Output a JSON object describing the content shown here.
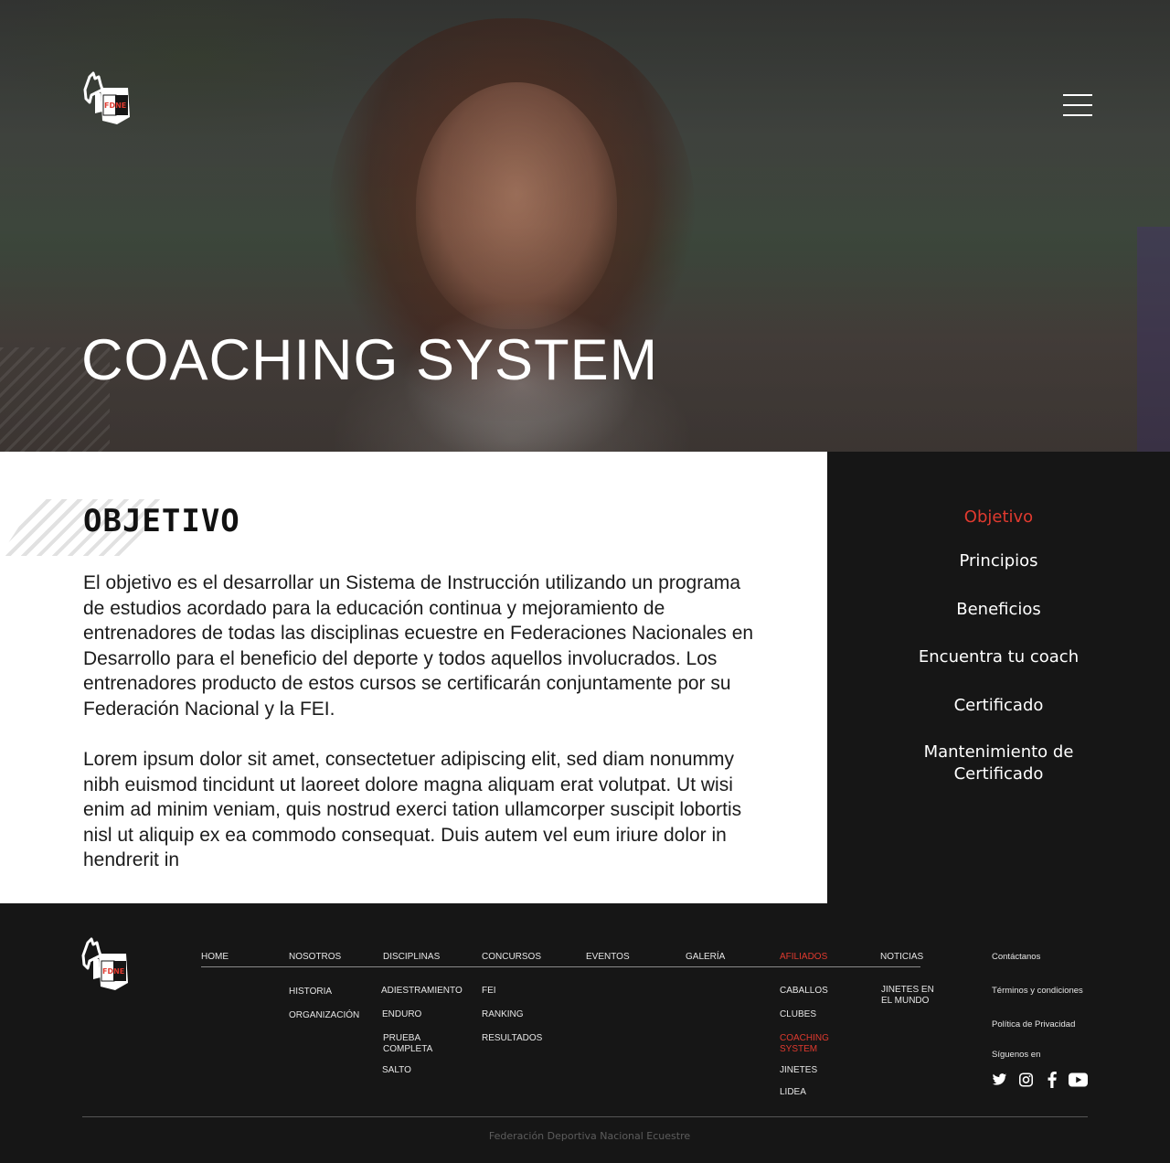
{
  "header": {
    "logo_text": "FDNE",
    "menu_icon": "hamburger-menu-icon",
    "title": "COACHING SYSTEM"
  },
  "content": {
    "section_title": "OBJETIVO",
    "paragraph_1": "El objetivo es el desarrollar un Sistema de Instrucción utilizando un programa de estudios acordado para la educación continua y mejoramiento de entrenadores de todas las disciplinas ecuestre en Federaciones Nacionales en Desarrollo para el beneficio del deporte y todos aquellos involucrados. Los entrenadores producto de estos cursos se certificarán conjuntamente por su Federación Nacional y la FEI.",
    "paragraph_2": "Lorem ipsum dolor sit amet, consectetuer adipiscing elit, sed diam nonummy nibh euismod tincidunt ut laoreet dolore magna aliquam erat volutpat. Ut wisi enim ad minim veniam, quis nostrud exerci tation ullamcorper suscipit lobortis nisl ut aliquip ex ea commodo consequat. Duis autem vel eum iriure dolor in hendrerit in"
  },
  "sidenav": {
    "items": [
      {
        "label": "Objetivo",
        "active": true
      },
      {
        "label": "Principios"
      },
      {
        "label": "Beneficios"
      },
      {
        "label": "Encuentra tu coach"
      },
      {
        "label": "Certificado"
      },
      {
        "label": "Mantenimiento de Certificado"
      }
    ]
  },
  "footer": {
    "nav": [
      {
        "label": "HOME"
      },
      {
        "label": "NOSOTROS",
        "sub": [
          "HISTORIA",
          "ORGANIZACIÓN"
        ]
      },
      {
        "label": "DISCIPLINAS",
        "sub": [
          "ADIESTRAMIENTO",
          "ENDURO",
          "PRUEBA COMPLETA",
          "SALTO"
        ]
      },
      {
        "label": "CONCURSOS",
        "sub": [
          "FEI",
          "RANKING",
          "RESULTADOS"
        ]
      },
      {
        "label": "EVENTOS"
      },
      {
        "label": "GALERÍA"
      },
      {
        "label": "AFILIADOS",
        "active": true,
        "sub": [
          "CABALLOS",
          "CLUBES",
          "COACHING SYSTEM",
          "JINETES",
          "LIDEA"
        ]
      },
      {
        "label": "NOTICIAS",
        "sub": [
          "JINETES EN EL MUNDO"
        ]
      }
    ],
    "links": {
      "contact": "Contáctanos",
      "terms": "Términos y condiciones",
      "privacy": "Política de Privacidad",
      "follow": "Síguenos en"
    },
    "social_icons": [
      "twitter-icon",
      "instagram-icon",
      "facebook-icon",
      "youtube-icon"
    ],
    "copyright": "Federación Deportiva Nacional Ecuestre"
  },
  "colors": {
    "accent": "#e03a2f",
    "dark": "#161616",
    "white": "#ffffff"
  }
}
